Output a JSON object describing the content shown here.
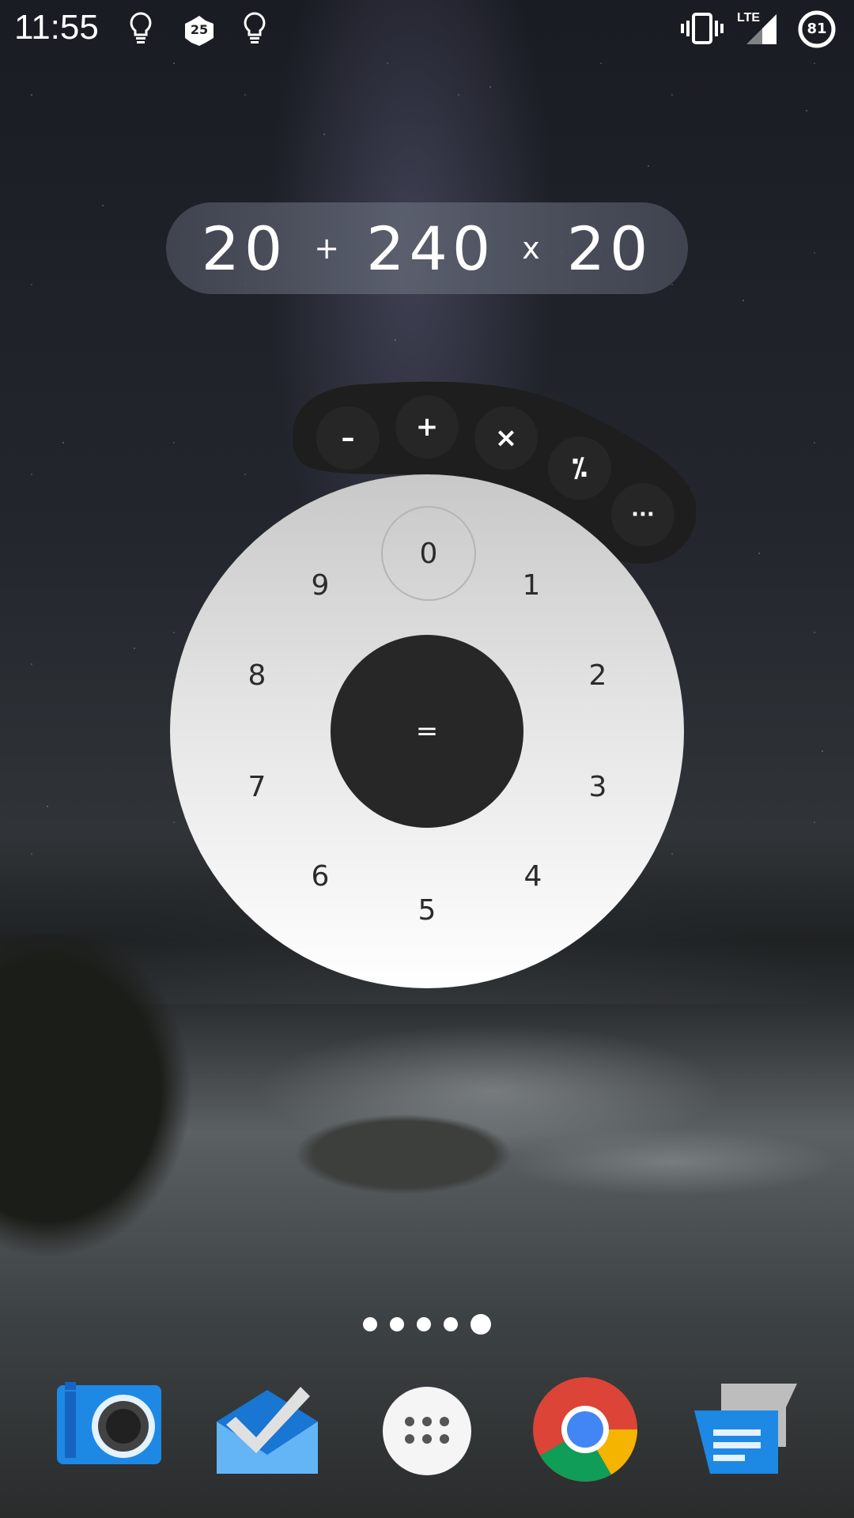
{
  "status_bar": {
    "time": "11:55",
    "notification_badge": "25",
    "network": "LTE",
    "battery": "81",
    "icons": [
      "lightbulb-icon",
      "notification-badge-icon",
      "lightbulb-icon",
      "vibrate-icon",
      "lte-signal-icon",
      "battery-icon"
    ]
  },
  "calculator": {
    "display": {
      "tokens": [
        {
          "type": "number",
          "text": "20"
        },
        {
          "type": "operator",
          "text": "+"
        },
        {
          "type": "number",
          "text": "240"
        },
        {
          "type": "operator",
          "text": "x"
        },
        {
          "type": "number",
          "text": "20"
        }
      ]
    },
    "operators": [
      {
        "label": "–",
        "name": "minus"
      },
      {
        "label": "+",
        "name": "plus"
      },
      {
        "label": "×",
        "name": "multiply"
      },
      {
        "label": "⁒",
        "name": "divide"
      },
      {
        "label": "···",
        "name": "more"
      }
    ],
    "digits": [
      "0",
      "1",
      "2",
      "3",
      "4",
      "5",
      "6",
      "7",
      "8",
      "9"
    ],
    "equals_label": "="
  },
  "home": {
    "page_count": 5,
    "active_page": 5,
    "dock_apps": [
      "Camera",
      "Inbox",
      "App drawer",
      "Chrome",
      "Messages"
    ]
  },
  "colors": {
    "dial_top": "#c8c8c8",
    "dial_bottom": "#ffffff",
    "dark_button": "#272727",
    "camera_blue": "#2196f3",
    "chrome_red": "#db4437",
    "chrome_green": "#0f9d58",
    "chrome_yellow": "#f4b400",
    "chrome_blue": "#4285f4"
  }
}
